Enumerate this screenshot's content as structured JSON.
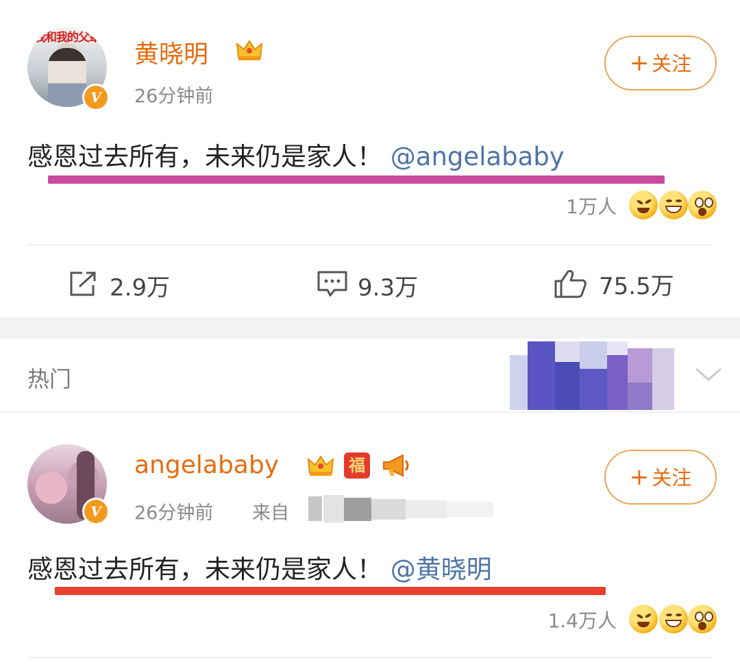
{
  "post1": {
    "avatar_poster_text": "我和我的父辈",
    "username": "黄晓明",
    "time": "26分钟前",
    "follow_label": "关注",
    "text": "感恩过去所有，未来仍是家人！",
    "mention": "@angelababy",
    "reaction_count": "1万人",
    "repost_count": "2.9万",
    "comment_count": "9.3万",
    "like_count": "75.5万",
    "underline_color": "#c84a9f"
  },
  "section": {
    "hot_label": "热门"
  },
  "post2": {
    "username": "angelababy",
    "fu_badge": "福",
    "time": "26分钟前",
    "source_prefix": "来自",
    "follow_label": "关注",
    "text": "感恩过去所有，未来仍是家人！",
    "mention": "@黄晓明",
    "reaction_count": "1.4万人",
    "underline_color": "#e8402d"
  },
  "icons": {
    "repost": "share-icon",
    "comment": "comment-icon",
    "like": "thumbs-up-icon",
    "crown": "crown-icon",
    "verified": "verified-v-icon",
    "megaphone": "megaphone-icon",
    "chevron": "chevron-down-icon"
  },
  "colors": {
    "username": "#e66c0f",
    "mention": "#4f74a6",
    "follow_border": "#e8a455"
  }
}
